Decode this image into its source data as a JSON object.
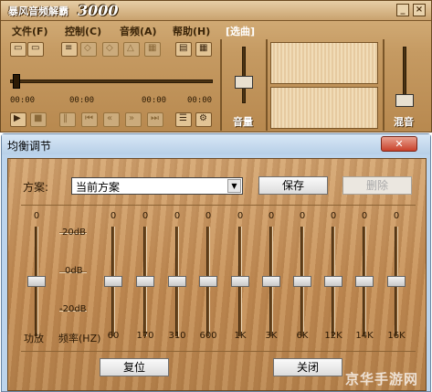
{
  "player": {
    "title": "暴风音频解霸",
    "logo_number": "3000",
    "window_buttons": [
      "_",
      "×"
    ],
    "menu": [
      {
        "label": "文件(F)"
      },
      {
        "label": "控制(C)"
      },
      {
        "label": "音频(A)"
      },
      {
        "label": "帮助(H)"
      },
      {
        "label": "[选曲]"
      }
    ],
    "time_left": "00:00",
    "time_mid": "00:00",
    "time_right": "00:00",
    "time_r2": "00:00",
    "volume_label": "音量",
    "mix_label": "混音"
  },
  "equalizer": {
    "title": "均衡调节",
    "close": "✕",
    "preset_label": "方案:",
    "preset_value": "当前方案",
    "save_button": "保存",
    "delete_button": "删除",
    "db_top": "20dB",
    "db_mid": "0dB",
    "db_bottom": "-20dB",
    "preamp_label": "功放",
    "freq_label": "频率(HZ)",
    "bands": [
      {
        "label": "",
        "value": "0"
      },
      {
        "label": "60",
        "value": "0"
      },
      {
        "label": "170",
        "value": "0"
      },
      {
        "label": "310",
        "value": "0"
      },
      {
        "label": "600",
        "value": "0"
      },
      {
        "label": "1K",
        "value": "0"
      },
      {
        "label": "3K",
        "value": "0"
      },
      {
        "label": "6K",
        "value": "0"
      },
      {
        "label": "12K",
        "value": "0"
      },
      {
        "label": "14K",
        "value": "0"
      },
      {
        "label": "16K",
        "value": "0"
      }
    ],
    "reset_button": "复位",
    "close_button": "关闭"
  },
  "watermark": "京华手游网"
}
